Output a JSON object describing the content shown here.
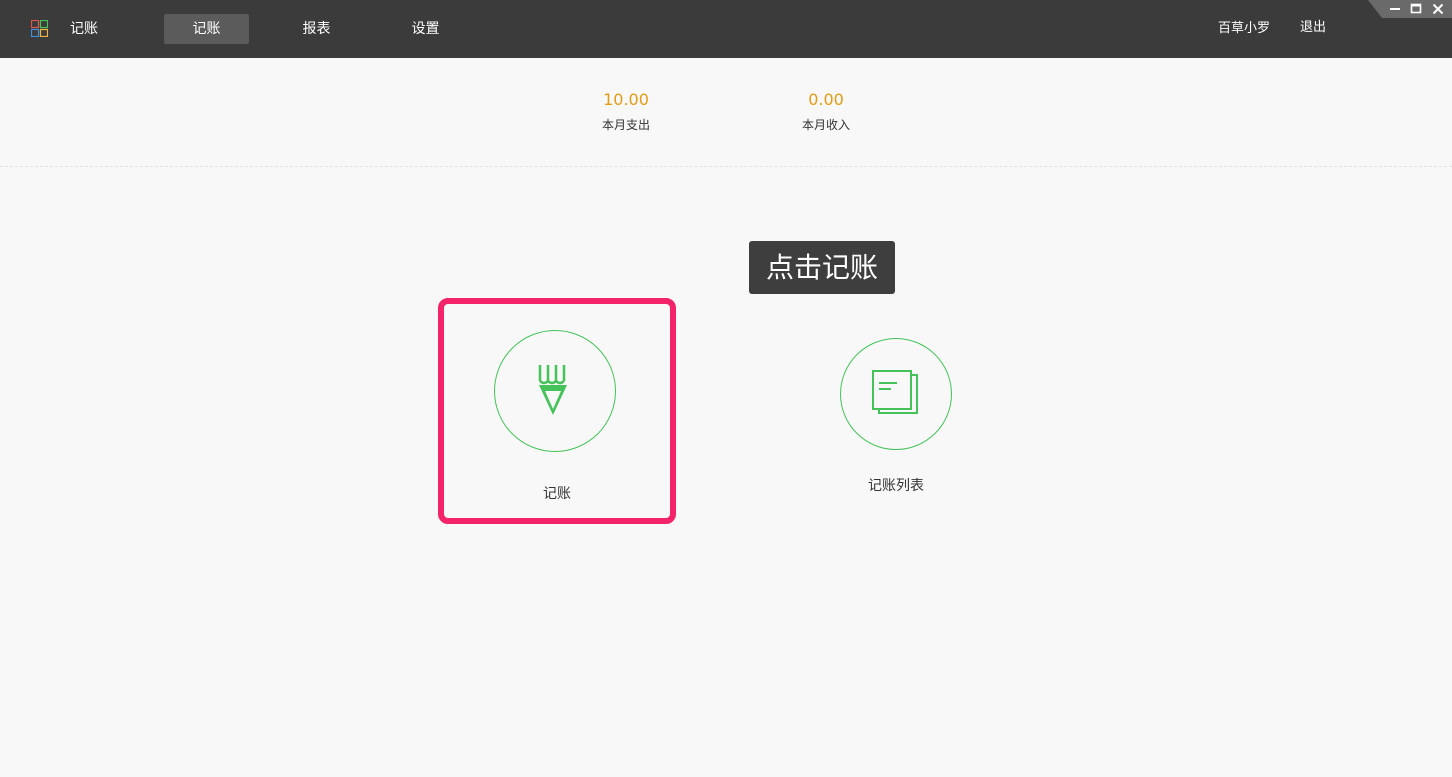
{
  "app": {
    "title": "记账"
  },
  "nav": {
    "tabs": [
      {
        "label": "记账",
        "active": true
      },
      {
        "label": "报表",
        "active": false
      },
      {
        "label": "设置",
        "active": false
      }
    ]
  },
  "user": {
    "name": "百草小罗",
    "logout_label": "退出"
  },
  "summary": {
    "expense": {
      "value": "10.00",
      "label": "本月支出"
    },
    "income": {
      "value": "0.00",
      "label": "本月收入"
    }
  },
  "tooltip": {
    "text": "点击记账"
  },
  "actions": {
    "record": {
      "label": "记账",
      "icon": "pencil-icon"
    },
    "list": {
      "label": "记账列表",
      "icon": "document-list-icon"
    }
  },
  "colors": {
    "topbar": "#3b3b3b",
    "accent_green": "#45c35a",
    "amount_orange": "#e39a14",
    "highlight_pink": "#f4246a"
  }
}
